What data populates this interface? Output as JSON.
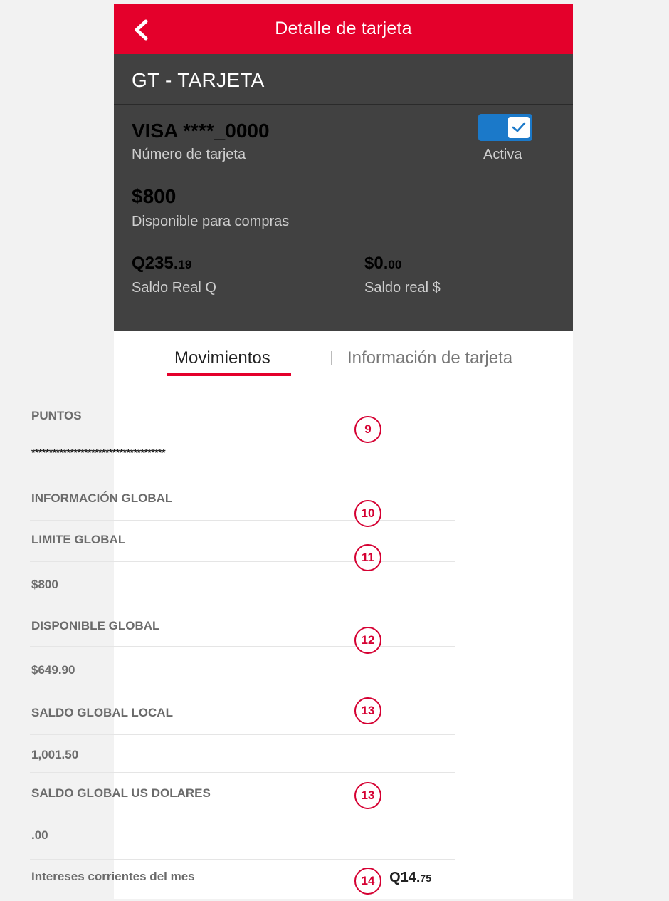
{
  "header": {
    "title": "Detalle de tarjeta"
  },
  "card": {
    "type_title": "GT - TARJETA",
    "number": "VISA ****_0000",
    "number_label": "Número de tarjeta",
    "status_label": "Activa",
    "status_active": true,
    "available": "$800",
    "available_label": "Disponible para compras",
    "balance_q_main": "Q235.",
    "balance_q_cents": "19",
    "balance_q_label": "Saldo Real Q",
    "balance_usd_main": "$0.",
    "balance_usd_cents": "00",
    "balance_usd_label": "Saldo real $"
  },
  "tabs": [
    {
      "label": "Movimientos",
      "selected": true
    },
    {
      "label": "Información de tarjeta",
      "selected": false
    }
  ],
  "rows": [
    {
      "text": "PUNTOS"
    },
    {
      "text": "**************************************"
    },
    {
      "text": "INFORMACIÓN GLOBAL"
    },
    {
      "text": "LIMITE GLOBAL"
    },
    {
      "text": "$800"
    },
    {
      "text": "DISPONIBLE GLOBAL"
    },
    {
      "text": "$649.90"
    },
    {
      "text": "SALDO GLOBAL LOCAL"
    },
    {
      "text": "1,001.50"
    },
    {
      "text": "SALDO GLOBAL US DOLARES"
    },
    {
      "text": ".00"
    },
    {
      "text": "Intereses corrientes del mes"
    }
  ],
  "interest": {
    "main": "Q14.",
    "cents": "75"
  },
  "badges": [
    "9",
    "10",
    "11",
    "12",
    "13",
    "13",
    "14"
  ],
  "colors": {
    "brand_red": "#e4002b",
    "dark": "#414141",
    "toggle_blue": "#1b79c9"
  }
}
